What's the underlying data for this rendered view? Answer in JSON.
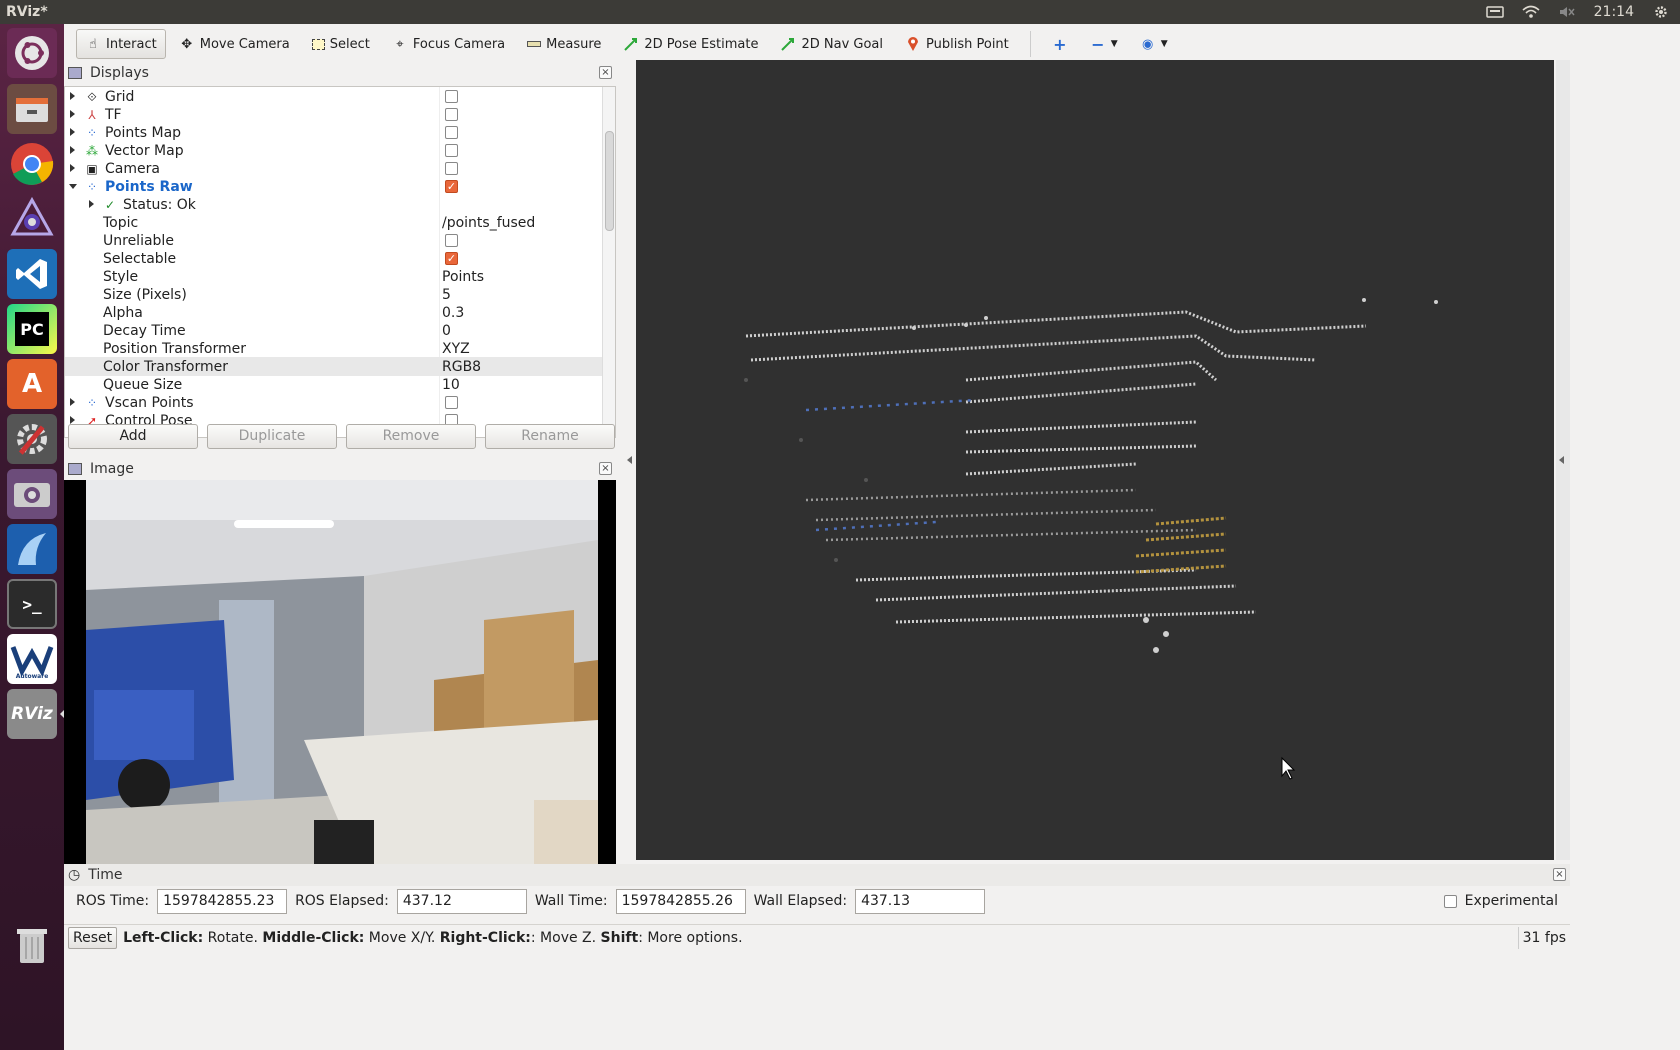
{
  "window": {
    "title": "RViz*"
  },
  "tray": {
    "clock": "21:14"
  },
  "launcher": {
    "items": [
      {
        "name": "ubuntu-dash",
        "label": ""
      },
      {
        "name": "files",
        "label": ""
      },
      {
        "name": "chrome",
        "label": ""
      },
      {
        "name": "ros-app",
        "label": ""
      },
      {
        "name": "vscode",
        "label": ""
      },
      {
        "name": "pycharm",
        "label": "PC"
      },
      {
        "name": "software-center",
        "label": "A"
      },
      {
        "name": "system-settings",
        "label": ""
      },
      {
        "name": "camera-app",
        "label": ""
      },
      {
        "name": "wireshark",
        "label": ""
      },
      {
        "name": "terminal",
        "label": ">_"
      },
      {
        "name": "autoware",
        "label": "Autoware"
      },
      {
        "name": "rviz",
        "label": "RViz"
      },
      {
        "name": "trash",
        "label": ""
      }
    ]
  },
  "toolbar": {
    "interact": "Interact",
    "move_camera": "Move Camera",
    "select": "Select",
    "focus_camera": "Focus Camera",
    "measure": "Measure",
    "pose_estimate": "2D Pose Estimate",
    "nav_goal": "2D Nav Goal",
    "publish_point": "Publish Point"
  },
  "displays": {
    "title": "Displays",
    "rows": [
      {
        "label": "Grid",
        "checked": false
      },
      {
        "label": "TF",
        "checked": false
      },
      {
        "label": "Points Map",
        "checked": false
      },
      {
        "label": "Vector Map",
        "checked": false
      },
      {
        "label": "Camera",
        "checked": false
      },
      {
        "label": "Points Raw",
        "checked": true
      },
      {
        "label": "Status: Ok"
      },
      {
        "label": "Topic",
        "value": "/points_fused"
      },
      {
        "label": "Unreliable",
        "checked": false
      },
      {
        "label": "Selectable",
        "checked": true
      },
      {
        "label": "Style",
        "value": "Points"
      },
      {
        "label": "Size (Pixels)",
        "value": "5"
      },
      {
        "label": "Alpha",
        "value": "0.3"
      },
      {
        "label": "Decay Time",
        "value": "0"
      },
      {
        "label": "Position Transformer",
        "value": "XYZ"
      },
      {
        "label": "Color Transformer",
        "value": "RGB8"
      },
      {
        "label": "Queue Size",
        "value": "10"
      },
      {
        "label": "Vscan Points",
        "checked": false
      },
      {
        "label": "Control Pose",
        "checked": false
      }
    ],
    "buttons": {
      "add": "Add",
      "duplicate": "Duplicate",
      "remove": "Remove",
      "rename": "Rename"
    }
  },
  "image_panel": {
    "title": "Image"
  },
  "time_panel": {
    "title": "Time",
    "ros_time_label": "ROS Time:",
    "ros_time": "1597842855.23",
    "ros_elapsed_label": "ROS Elapsed:",
    "ros_elapsed": "437.12",
    "wall_time_label": "Wall Time:",
    "wall_time": "1597842855.26",
    "wall_elapsed_label": "Wall Elapsed:",
    "wall_elapsed": "437.13",
    "experimental": "Experimental"
  },
  "status": {
    "reset": "Reset",
    "left_click": "Left-Click:",
    "left_action": " Rotate. ",
    "middle_click": "Middle-Click:",
    "middle_action": " Move X/Y. ",
    "right_click": "Right-Click:",
    "right_action": ": Move Z. ",
    "shift": "Shift",
    "shift_action": ": More options.",
    "fps": "31 fps"
  },
  "colors": {
    "accent": "#e9673a",
    "launcher": "#3b1830",
    "viewport": "#303030",
    "selected_link": "#1a66c9"
  }
}
